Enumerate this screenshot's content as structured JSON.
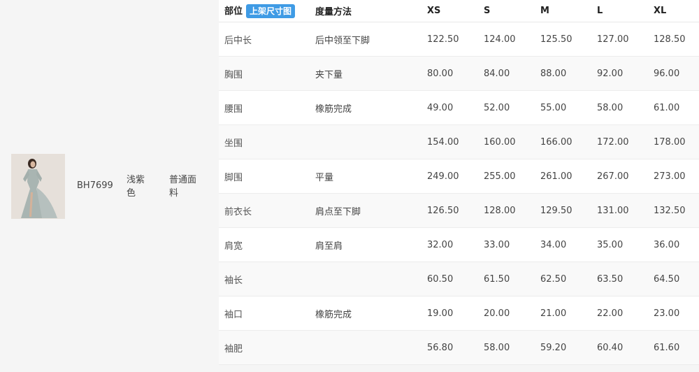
{
  "product": {
    "sku": "BH7699",
    "color": "浅紫色",
    "material": "普通面料",
    "thumbnail_icon": "dress-photo-thumbnail"
  },
  "size_table": {
    "headers": {
      "part": "部位",
      "badge": "上架尺寸图",
      "method": "度量方法",
      "sizes": [
        "XS",
        "S",
        "M",
        "L",
        "XL"
      ]
    },
    "rows": [
      {
        "part": "后中长",
        "method": "后中领至下脚",
        "values": [
          "122.50",
          "124.00",
          "125.50",
          "127.00",
          "128.50"
        ]
      },
      {
        "part": "胸围",
        "method": "夹下量",
        "values": [
          "80.00",
          "84.00",
          "88.00",
          "92.00",
          "96.00"
        ]
      },
      {
        "part": "腰围",
        "method": "橡筋完成",
        "values": [
          "49.00",
          "52.00",
          "55.00",
          "58.00",
          "61.00"
        ]
      },
      {
        "part": "坐围",
        "method": "",
        "values": [
          "154.00",
          "160.00",
          "166.00",
          "172.00",
          "178.00"
        ]
      },
      {
        "part": "脚围",
        "method": "平量",
        "values": [
          "249.00",
          "255.00",
          "261.00",
          "267.00",
          "273.00"
        ]
      },
      {
        "part": "前衣长",
        "method": "肩点至下脚",
        "values": [
          "126.50",
          "128.00",
          "129.50",
          "131.00",
          "132.50"
        ]
      },
      {
        "part": "肩宽",
        "method": "肩至肩",
        "values": [
          "32.00",
          "33.00",
          "34.00",
          "35.00",
          "36.00"
        ]
      },
      {
        "part": "袖长",
        "method": "",
        "values": [
          "60.50",
          "61.50",
          "62.50",
          "63.50",
          "64.50"
        ]
      },
      {
        "part": "袖口",
        "method": "橡筋完成",
        "values": [
          "19.00",
          "20.00",
          "21.00",
          "22.00",
          "23.00"
        ]
      },
      {
        "part": "袖肥",
        "method": "",
        "values": [
          "56.80",
          "58.00",
          "59.20",
          "60.40",
          "61.60"
        ]
      }
    ]
  },
  "colors": {
    "badge": "#3f9be5",
    "page_bg": "#f5f5f5",
    "row_alt": "#f9f9f9"
  }
}
